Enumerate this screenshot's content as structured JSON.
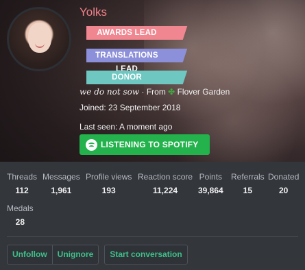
{
  "profile": {
    "username": "Yolks",
    "badges": [
      {
        "label": "AWARDS LEAD",
        "color": "#ef8690"
      },
      {
        "label": "TRANSLATIONS LEAD",
        "color": "#8c8fd9"
      },
      {
        "label": "DONOR",
        "color": "#6ec7c1"
      }
    ],
    "custom_title": "we do not sow",
    "from_prefix": "· From",
    "location_icon": "four-leaf-clover-icon",
    "location": "Flover Garden",
    "joined": "Joined: 23 September 2018",
    "last_seen": "Last seen: A moment ago",
    "spotify_label": "LISTENING TO SPOTIFY",
    "spotify_color": "#23b24c",
    "username_color": "#f0828a"
  },
  "stats": [
    {
      "label": "Threads",
      "value": "112"
    },
    {
      "label": "Messages",
      "value": "1,961"
    },
    {
      "label": "Profile views",
      "value": "193"
    },
    {
      "label": "Reaction score",
      "value": "11,224"
    },
    {
      "label": "Points",
      "value": "39,864"
    },
    {
      "label": "Referrals",
      "value": "15"
    },
    {
      "label": "Donated",
      "value": "20"
    }
  ],
  "medals": {
    "label": "Medals",
    "value": "28"
  },
  "actions": {
    "unfollow": "Unfollow",
    "unignore": "Unignore",
    "start_conversation": "Start conversation",
    "accent": "#3fc08a"
  }
}
